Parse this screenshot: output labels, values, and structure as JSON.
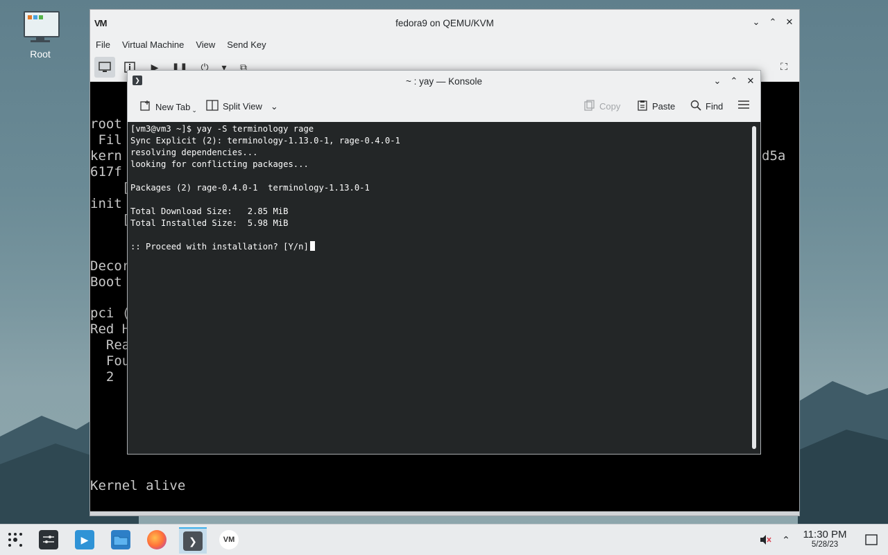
{
  "desktop": {
    "icon_label": "Root"
  },
  "vm_window": {
    "title": "fedora9 on QEMU/KVM",
    "logo": "VM",
    "menu": [
      "File",
      "Virtual Machine",
      "View",
      "Send Key"
    ],
    "console_lines": [
      "root",
      " Fil",
      "kern",
      "617f",
      "    [",
      "init",
      "    [",
      "",
      "Decor",
      "Boot",
      "",
      "pci (",
      "Red H",
      "  Rea",
      "  Fou",
      "  2"
    ],
    "console_right": "d5a",
    "console_bottom": "Kernel alive"
  },
  "konsole": {
    "title": "~ : yay — Konsole",
    "toolbar": {
      "new_tab": "New Tab",
      "split_view": "Split View",
      "copy": "Copy",
      "paste": "Paste",
      "find": "Find"
    },
    "terminal": {
      "lines": [
        "[vm3@vm3 ~]$ yay -S terminology rage",
        "Sync Explicit (2): terminology-1.13.0-1, rage-0.4.0-1",
        "resolving dependencies...",
        "looking for conflicting packages...",
        "",
        "Packages (2) rage-0.4.0-1  terminology-1.13.0-1",
        "",
        "Total Download Size:   2.85 MiB",
        "Total Installed Size:  5.98 MiB",
        "",
        ":: Proceed with installation? [Y/n]"
      ]
    }
  },
  "taskbar": {
    "clock_time": "11:30 PM",
    "clock_date": "5/28/23"
  }
}
